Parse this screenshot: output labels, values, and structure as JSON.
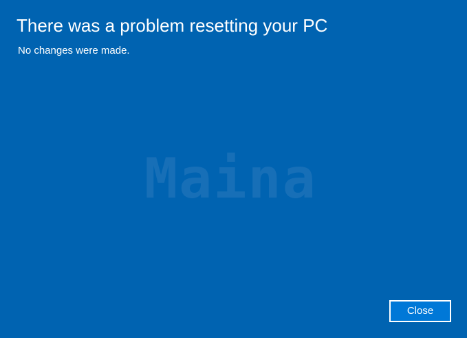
{
  "dialog": {
    "title": "There was a problem resetting your PC",
    "message": "No changes were made.",
    "watermark": "Maina",
    "close_label": "Close"
  },
  "colors": {
    "background": "#0063b1",
    "button_background": "#0078d7",
    "text": "#ffffff",
    "watermark": "#2a79bd"
  }
}
